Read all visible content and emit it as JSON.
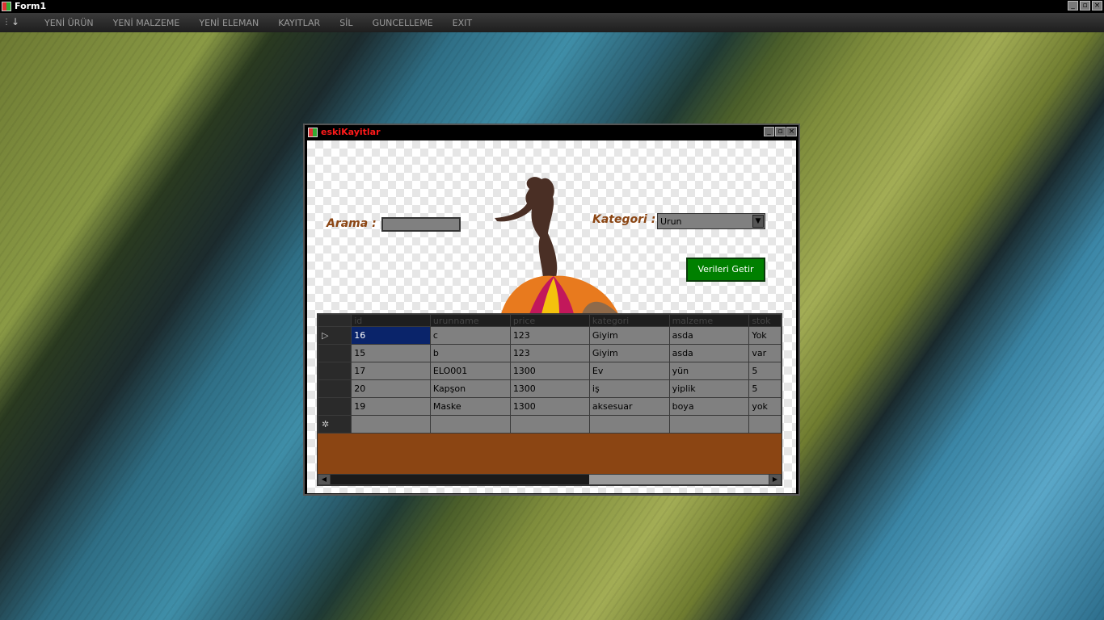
{
  "window": {
    "title": "Form1"
  },
  "menu": {
    "items": [
      "YENİ ÜRÜN",
      "YENİ MALZEME",
      "YENİ ELEMAN",
      "KAYITLAR",
      "SİL",
      "GUNCELLEME",
      "EXIT"
    ]
  },
  "child": {
    "title": "eskiKayitlar",
    "search_label": "Arama :",
    "search_value": "",
    "category_label": "Kategori :",
    "category_value": "Urun",
    "fetch_button": "Verileri Getir"
  },
  "table": {
    "columns": [
      "id",
      "urunname",
      "price",
      "kategori",
      "malzeme",
      "stok"
    ],
    "rows": [
      [
        "16",
        "c",
        "123",
        "Giyim",
        "asda",
        "Yok"
      ],
      [
        "15",
        "b",
        "123",
        "Giyim",
        "asda",
        "var"
      ],
      [
        "17",
        "ELO001",
        "1300",
        "Ev",
        "yün",
        "5"
      ],
      [
        "20",
        "Kapşon",
        "1300",
        "iş",
        "yiplik",
        "5"
      ],
      [
        "19",
        "Maske",
        "1300",
        "aksesuar",
        "boya",
        "yok"
      ]
    ]
  },
  "colors": {
    "accent_title": "#ff1a1a",
    "label": "#8b4513",
    "button": "#008000",
    "selection": "#0a246a"
  }
}
